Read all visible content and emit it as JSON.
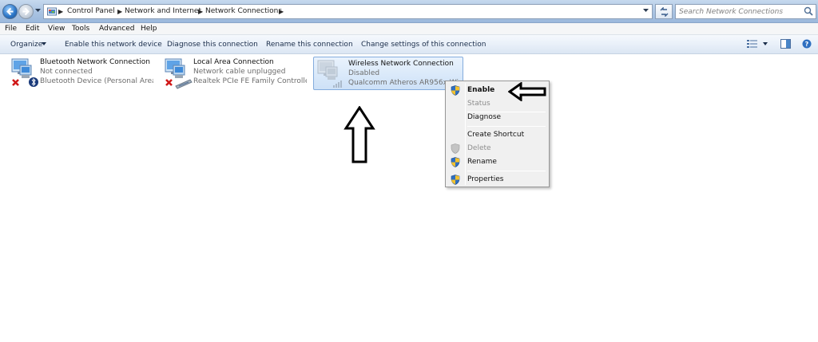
{
  "address": {
    "crumbs": [
      "Control Panel",
      "Network and Internet",
      "Network Connections"
    ]
  },
  "search": {
    "placeholder": "Search Network Connections"
  },
  "menu": [
    "File",
    "Edit",
    "View",
    "Tools",
    "Advanced",
    "Help"
  ],
  "commands": {
    "organize": "Organize",
    "enable": "Enable this network device",
    "diagnose": "Diagnose this connection",
    "rename": "Rename this connection",
    "change": "Change settings of this connection"
  },
  "connections": [
    {
      "name": "Bluetooth Network Connection",
      "status": "Not connected",
      "device": "Bluetooth Device (Personal Area ..."
    },
    {
      "name": "Local Area Connection",
      "status": "Network cable unplugged",
      "device": "Realtek PCIe FE Family Controller"
    },
    {
      "name": "Wireless Network Connection",
      "status": "Disabled",
      "device": "Qualcomm Atheros AR956x Wirel..."
    }
  ],
  "context_menu": {
    "enable": "Enable",
    "status": "Status",
    "diagnose": "Diagnose",
    "create_shortcut": "Create Shortcut",
    "delete": "Delete",
    "rename": "Rename",
    "properties": "Properties"
  },
  "colors": {
    "selection": "#cde1f7",
    "error_x": "#d01818",
    "shield_blue": "#2f6fc0",
    "shield_yellow": "#f2c12e"
  },
  "icons": [
    "back-icon",
    "forward-icon",
    "folder-icon",
    "refresh-icon",
    "search-icon",
    "network-icon",
    "bluetooth-icon",
    "shield-icon",
    "view-icon",
    "pane-icon",
    "help-icon"
  ]
}
